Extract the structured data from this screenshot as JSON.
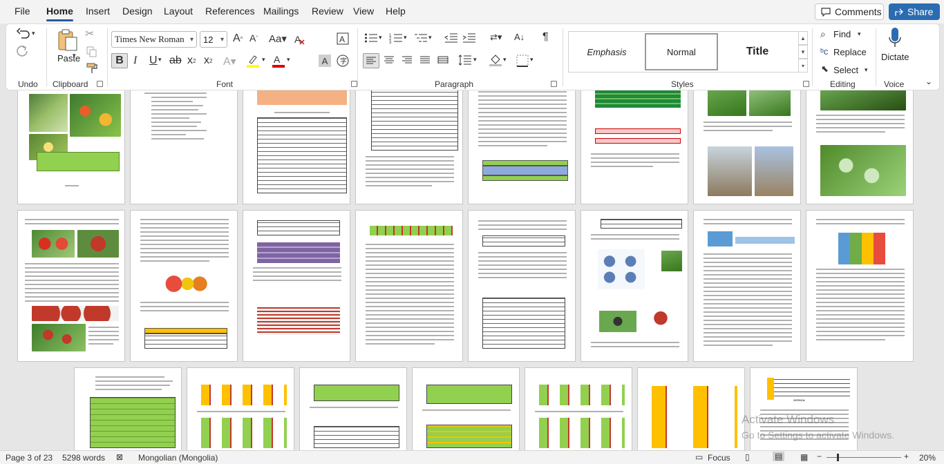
{
  "menu": {
    "tabs": [
      "File",
      "Home",
      "Insert",
      "Design",
      "Layout",
      "References",
      "Mailings",
      "Review",
      "View",
      "Help"
    ],
    "active": "Home",
    "comments_label": "Comments",
    "share_label": "Share"
  },
  "ribbon": {
    "groups": {
      "undo": "Undo",
      "clipboard": "Clipboard",
      "font": "Font",
      "paragraph": "Paragraph",
      "styles": "Styles",
      "editing": "Editing",
      "voice": "Voice"
    },
    "paste_label": "Paste",
    "font_name": "Times New Roman",
    "font_size": "12",
    "styles": [
      "Emphasis",
      "Normal",
      "Title"
    ],
    "selected_style": "Normal",
    "find_label": "Find",
    "replace_label": "Replace",
    "select_label": "Select",
    "dictate_label": "Dictate"
  },
  "document": {
    "last_page_heading": "ХУЛОСА",
    "watermark_line1": "Activate Windows",
    "watermark_line2": "Go to Settings to activate Windows."
  },
  "status": {
    "page": "Page 3 of 23",
    "words": "5298 words",
    "language": "Mongolian (Mongolia)",
    "focus": "Focus",
    "zoom": "20%"
  },
  "colors": {
    "accent": "#2b579a",
    "share": "#2b6cb0",
    "table_green": "#92d050",
    "table_orange": "#f4b183",
    "table_blue": "#8ea9db",
    "table_purple": "#8064a2",
    "table_yellow": "#ffc000"
  }
}
